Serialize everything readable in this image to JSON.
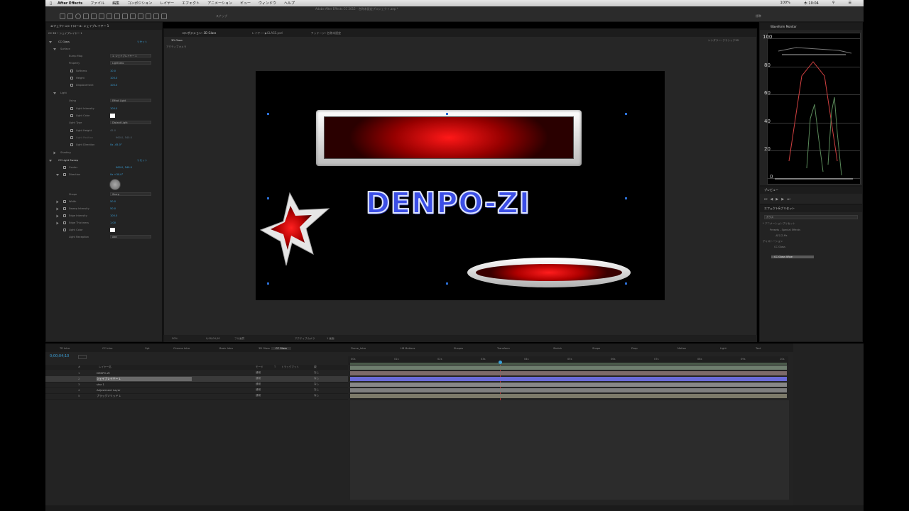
{
  "app": {
    "name": "After Effects",
    "menus": [
      "ファイル",
      "編集",
      "コンポジション",
      "レイヤー",
      "エフェクト",
      "アニメーション",
      "ビュー",
      "ウィンドウ",
      "ヘルプ"
    ],
    "status_right": [
      "100%",
      "木 10:04"
    ],
    "window_title": "Adobe After Effects CC 2015 - 名称未設定プロジェクト.aep *"
  },
  "toolbar": {
    "snap_label": "スナップ",
    "workspace": "標準"
  },
  "effect_controls": {
    "tab_label": "エフェクトコントロール: シェイプレイヤー 1",
    "title": "CC 3D • シェイプレイヤー 1",
    "properties": [
      {
        "label": "CC Glass",
        "value": "",
        "action": "リセット"
      },
      {
        "label": "Surface",
        "value": ""
      },
      {
        "label": "Bump Map",
        "value": "1. シェイプレイヤー 1"
      },
      {
        "label": "Property",
        "value": "Lightness"
      },
      {
        "label": "Softness",
        "value": "10.0"
      },
      {
        "label": "Height",
        "value": "100.0"
      },
      {
        "label": "Displacement",
        "value": "100.0"
      },
      {
        "label": "Light",
        "value": ""
      },
      {
        "label": "Using",
        "value": "Effect Light"
      },
      {
        "label": "Light Intensity",
        "value": "100.0"
      },
      {
        "label": "Light Color",
        "value": ""
      },
      {
        "label": "Light Type",
        "value": "Distant Light"
      },
      {
        "label": "Light Height",
        "value": "45.0"
      },
      {
        "label": "Light Position",
        "value": "960.0, 540.0"
      },
      {
        "label": "Light Direction",
        "value": "0x -45.0°"
      },
      {
        "label": "Shading",
        "value": ""
      },
      {
        "label": "CC Light Sweep",
        "value": "",
        "action": "リセット"
      },
      {
        "label": "Center",
        "value": "960.0, 540.0"
      },
      {
        "label": "Direction",
        "value": "0x +30.0°"
      },
      {
        "label": "Shape",
        "value": "Sharp"
      },
      {
        "label": "Width",
        "value": "50.0"
      },
      {
        "label": "Sweep Intensity",
        "value": "50.0"
      },
      {
        "label": "Edge Intensity",
        "value": "100.0"
      },
      {
        "label": "Edge Thickness",
        "value": "1.00"
      },
      {
        "label": "Light Color",
        "value": ""
      },
      {
        "label": "Light Reception",
        "value": "Add"
      }
    ]
  },
  "composition": {
    "tabs": [
      "コンポジション: 3D Glass",
      "レイヤー: ▶︎GLASS.psd",
      "フッテージ: 名称未設定"
    ],
    "viewer_tab": "3D Glass",
    "renderer": "レンダラー: クラシック3D",
    "active_camera": "アクティブカメラ",
    "canvas_text": "DENPO-ZI",
    "footer": [
      "50%",
      "0;00;04;10",
      "フル画質",
      "アクティブカメラ",
      "1 画面"
    ]
  },
  "histogram": {
    "tab": "Waveform Monitor",
    "ticks": [
      "100",
      "80",
      "60",
      "40",
      "20",
      "0"
    ]
  },
  "preview": {
    "tab": "プレビュー"
  },
  "effects_presets": {
    "tab": "エフェクト&プリセット",
    "search": "ガラス",
    "items": [
      "* アニメーションプリセット",
      "Presets - Special Effects",
      "ガラス.ffx",
      "ディストーション",
      "CC Glass",
      "CC Glass Wipe"
    ]
  },
  "timeline": {
    "tabs": [
      "TR Intro",
      "CC Intro",
      "Opt",
      "Cinema Intro",
      "Basic Intro",
      "3D Glass",
      "CC Glass",
      "Flame_Intro",
      "HB Motions",
      "Shapes",
      "Transform",
      "Sketch",
      "Shape",
      "Drop",
      "Motion",
      "Light",
      "Text"
    ],
    "timecode": "0;00;04;10",
    "columns": [
      "#",
      "レイヤー名",
      "モード",
      "T",
      "トラックマット",
      "親"
    ],
    "layers": [
      {
        "num": "1",
        "name": "DENPO-ZI",
        "mode": "通常",
        "parent": "なし",
        "color": "#8a8a8a"
      },
      {
        "num": "2",
        "name": "シェイプレイヤー 1",
        "mode": "通常",
        "parent": "なし",
        "color": "#6b6bd6"
      },
      {
        "num": "3",
        "name": "star 1",
        "mode": "通常",
        "parent": "なし",
        "color": "#8a8a8a"
      },
      {
        "num": "4",
        "name": "Adjustment Layer",
        "mode": "通常",
        "parent": "なし",
        "color": "#8a8a8a"
      },
      {
        "num": "5",
        "name": "ブラックソリッド 1",
        "mode": "通常",
        "parent": "なし",
        "color": "#8a8a8a"
      }
    ],
    "ruler": [
      "00s",
      "01s",
      "02s",
      "03s",
      "04s",
      "05s",
      "06s",
      "07s",
      "08s",
      "09s",
      "10s"
    ]
  }
}
